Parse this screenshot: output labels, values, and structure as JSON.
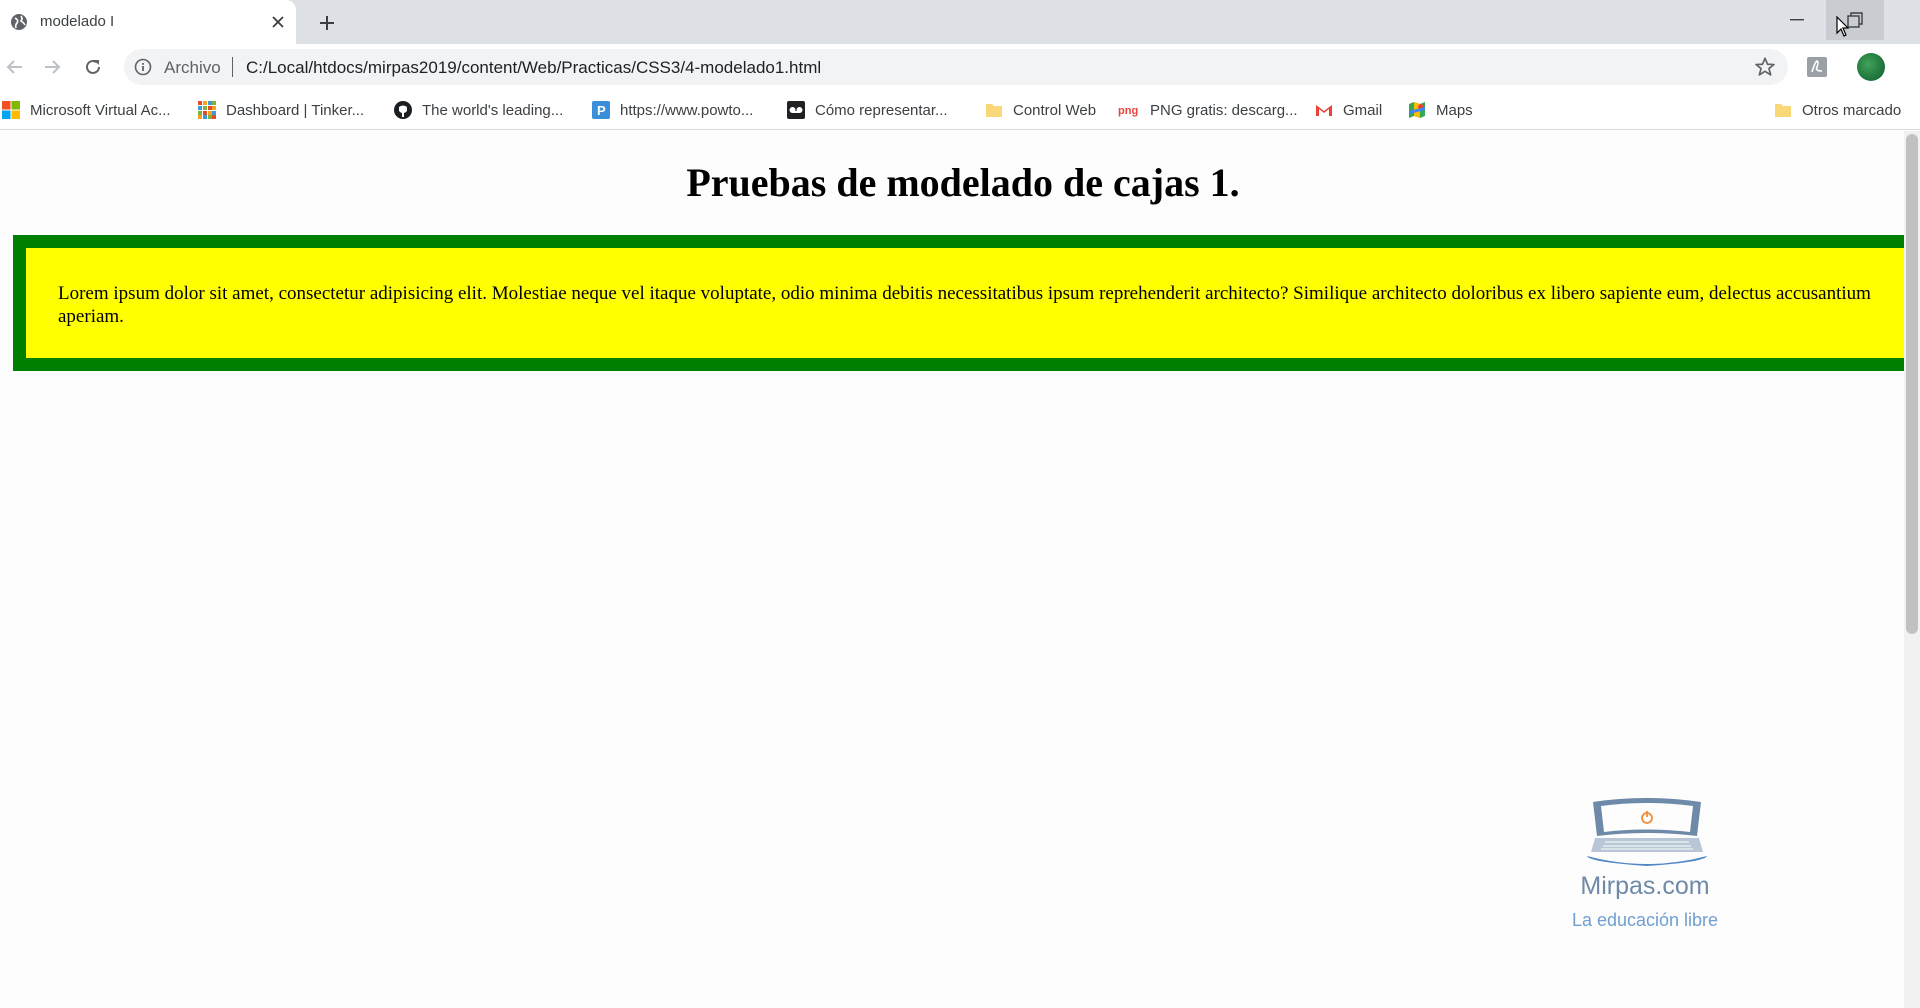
{
  "tab": {
    "title": "modelado I"
  },
  "omnibox": {
    "scheme_label": "Archivo",
    "url": "C:/Local/htdocs/mirpas2019/content/Web/Practicas/CSS3/4-modelado1.html"
  },
  "bookmarks": [
    {
      "label": "Microsoft Virtual Ac...",
      "icon": "microsoft-icon"
    },
    {
      "label": "Dashboard | Tinker...",
      "icon": "tinkercad-icon"
    },
    {
      "label": "The world's leading...",
      "icon": "github-icon"
    },
    {
      "label": "https://www.powto...",
      "icon": "powtoon-icon"
    },
    {
      "label": "Cómo representar...",
      "icon": "video-icon"
    },
    {
      "label": "Control Web",
      "icon": "folder-icon"
    },
    {
      "label": "PNG gratis: descarg...",
      "icon": "png-icon"
    },
    {
      "label": "Gmail",
      "icon": "gmail-icon"
    },
    {
      "label": "Maps",
      "icon": "maps-icon"
    },
    {
      "label": "Otros marcado",
      "icon": "folder-icon"
    }
  ],
  "page": {
    "heading": "Pruebas de modelado de cajas 1.",
    "paragraph": "Lorem ipsum dolor sit amet, consectetur adipisicing elit. Molestiae neque vel itaque voluptate, odio minima debitis necessitatibus ipsum reprehenderit architecto? Similique architecto doloribus ex libero sapiente eum, delectus accusantium aperiam.",
    "box_background": "#ffff00",
    "box_border_color": "#008000"
  },
  "watermark": {
    "name": "Mirpas.com",
    "tagline": "La educación libre"
  }
}
